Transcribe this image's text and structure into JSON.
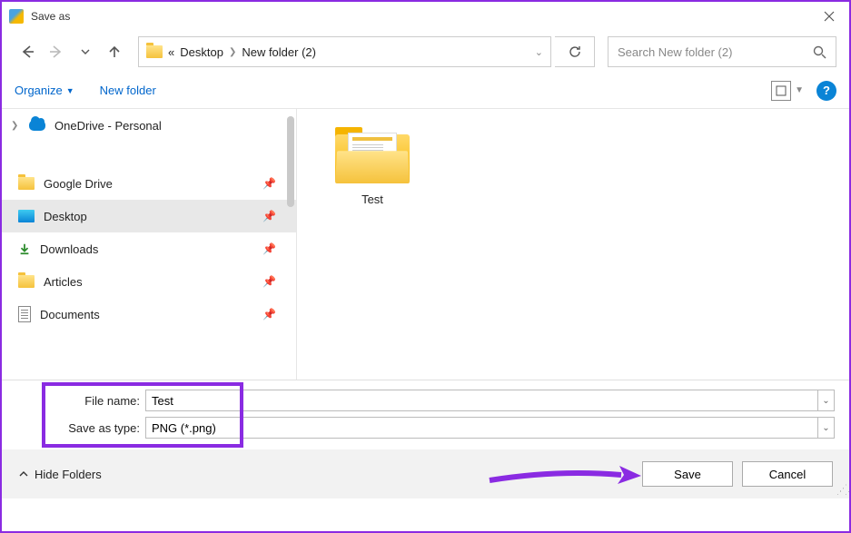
{
  "window": {
    "title": "Save as"
  },
  "nav": {
    "prefix": "«",
    "crumbs": [
      "Desktop",
      "New folder (2)"
    ]
  },
  "search": {
    "placeholder": "Search New folder (2)"
  },
  "toolbar": {
    "organize": "Organize",
    "newfolder": "New folder",
    "help": "?"
  },
  "tree": {
    "onedrive": "OneDrive - Personal",
    "items": [
      {
        "label": "Google Drive",
        "icon": "folder"
      },
      {
        "label": "Desktop",
        "icon": "desktop",
        "selected": true
      },
      {
        "label": "Downloads",
        "icon": "download"
      },
      {
        "label": "Articles",
        "icon": "folder"
      },
      {
        "label": "Documents",
        "icon": "doc"
      }
    ]
  },
  "content": {
    "items": [
      {
        "label": "Test"
      }
    ]
  },
  "form": {
    "filename_label": "File name:",
    "filename_value": "Test",
    "saveas_label": "Save as type:",
    "saveas_value": "PNG (*.png)"
  },
  "footer": {
    "hide_folders": "Hide Folders",
    "save": "Save",
    "cancel": "Cancel"
  }
}
